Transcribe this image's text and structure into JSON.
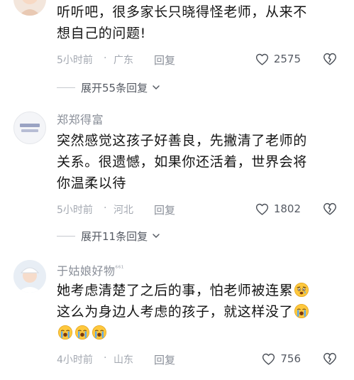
{
  "comments": [
    {
      "text_lines": [
        "听听吧，很多家长只晓得怪老师，从来不",
        "想自己的问题!"
      ],
      "time": "5小时前",
      "location": "广东",
      "reply_label": "回复",
      "likes": "2575",
      "expand_label": "展开55条回复"
    },
    {
      "username": "郑郑得富",
      "text_lines": [
        "突然感觉这孩子好善良，先撇清了老师的",
        "关系。很遗憾，如果你还活着，世界会将",
        "你温柔以待"
      ],
      "time": "5小时前",
      "location": "河北",
      "reply_label": "回复",
      "likes": "1802",
      "expand_label": "展开11条回复"
    },
    {
      "username": "于姑娘好物",
      "username_badge": "⁶⁶¹",
      "text_lines": [
        "她考虑清楚了之后的事，怕老师被连累",
        "这么为身边人考虑的孩子，就这样没了"
      ],
      "time": "4小时前",
      "location": "山东",
      "reply_label": "回复",
      "likes": "756"
    }
  ],
  "separator": "·",
  "icons": {
    "like": "heart-outline-icon",
    "dislike": "broken-heart-icon",
    "expand": "chevron-down-icon",
    "emoji_worried": "worried-face-emoji",
    "emoji_crying": "loudly-crying-face-emoji"
  },
  "colors": {
    "text": "#141414",
    "meta": "#a3a8b1",
    "username": "#8a8f99",
    "emoji_yellow": "#ffc83d",
    "tears": "#5aa9ef"
  }
}
